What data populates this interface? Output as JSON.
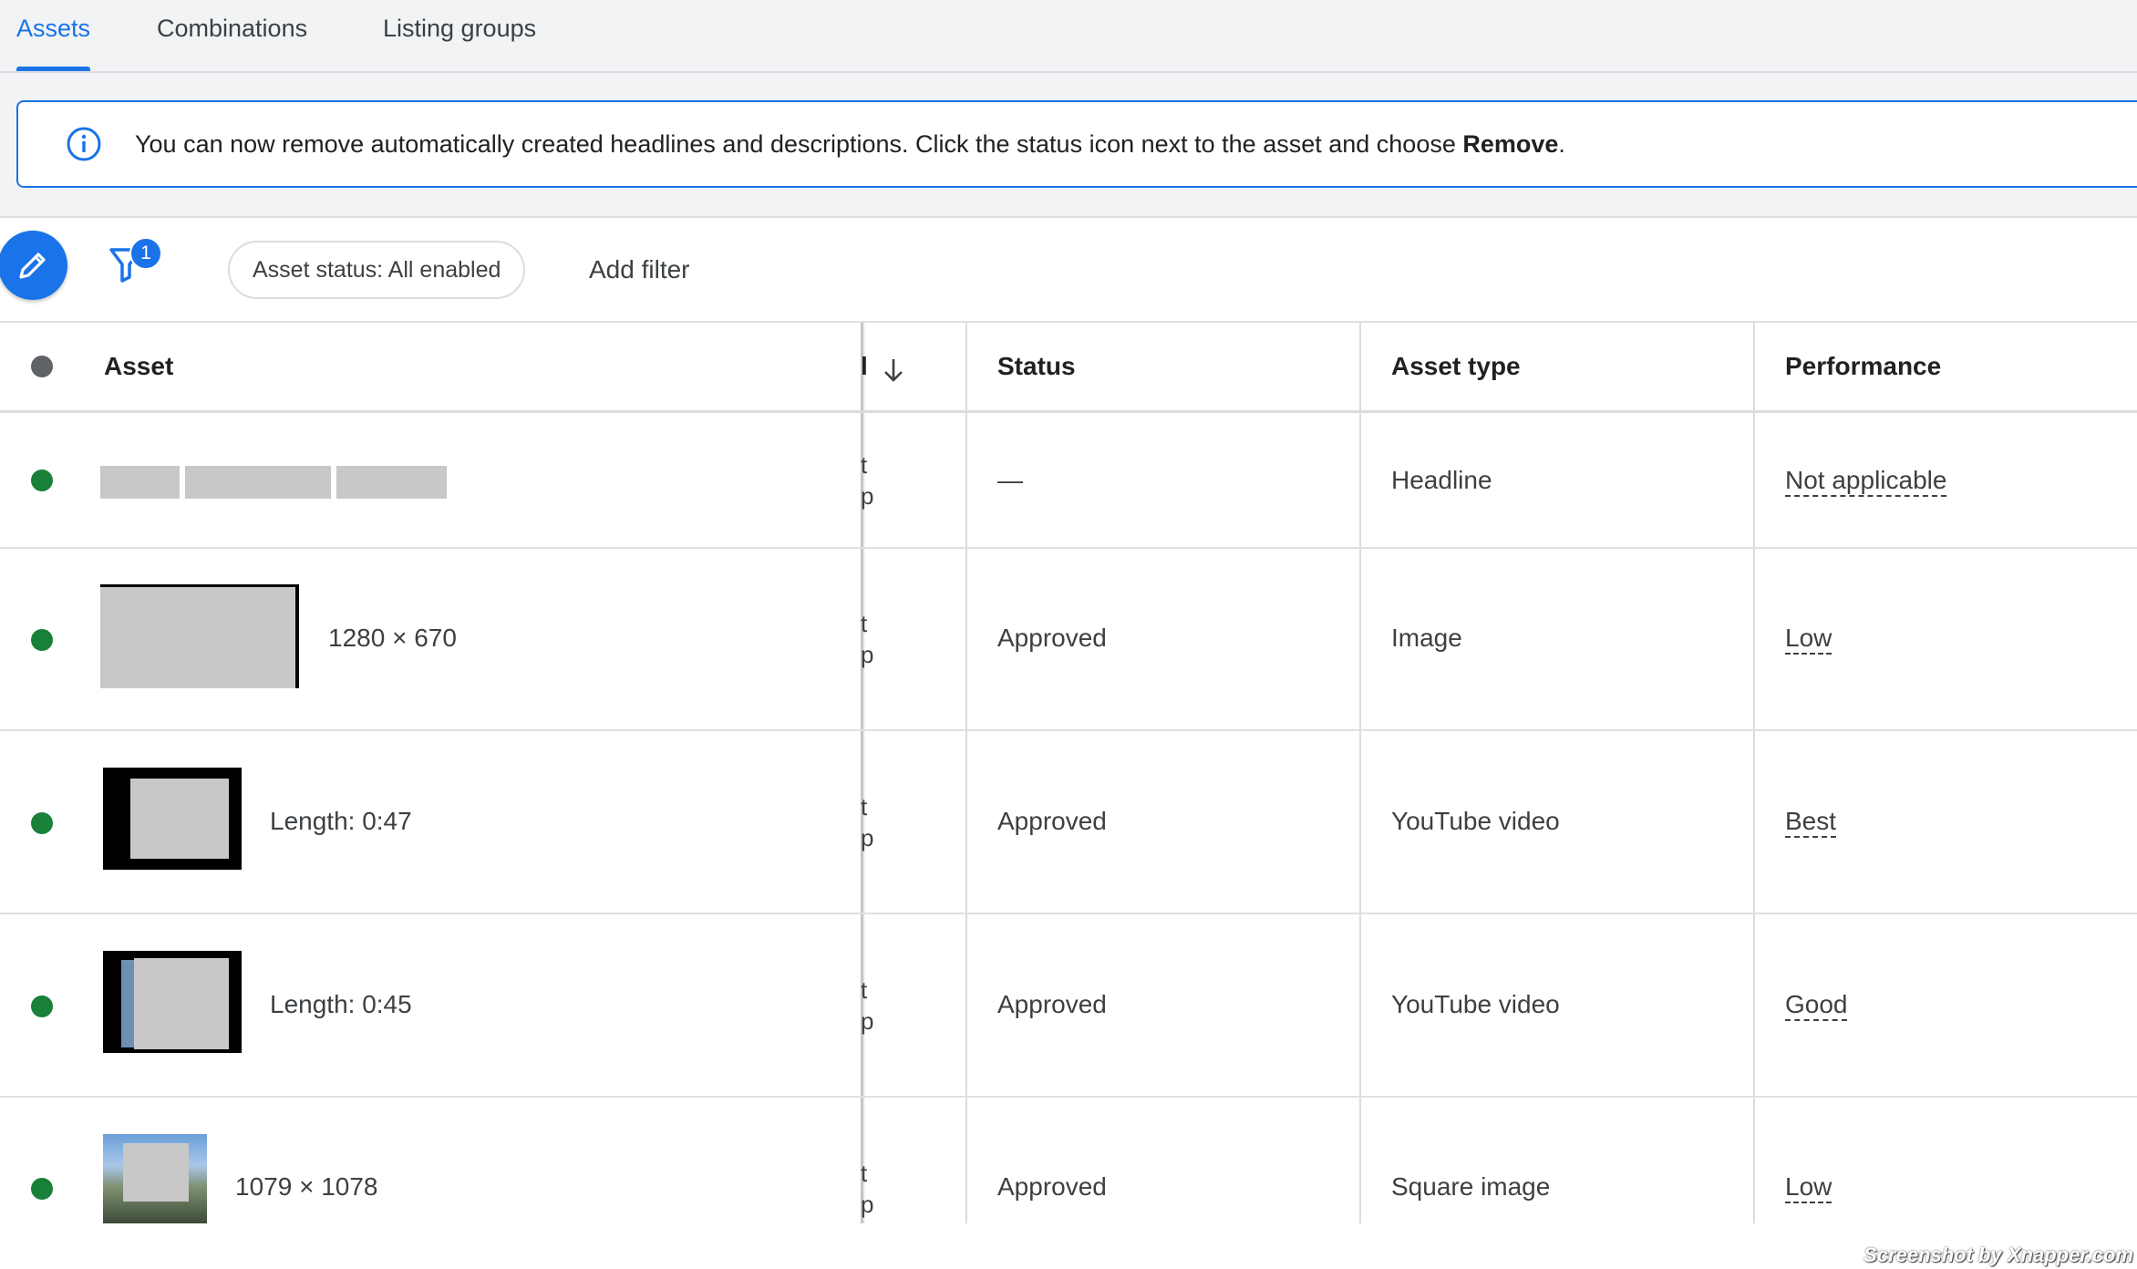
{
  "tabs": [
    {
      "label": "Assets",
      "active": true
    },
    {
      "label": "Combinations",
      "active": false
    },
    {
      "label": "Listing groups",
      "active": false
    }
  ],
  "banner": {
    "text": "You can now remove automatically created headlines and descriptions. Click the status icon next to the asset and choose ",
    "bold": "Remove",
    "end": "."
  },
  "toolbar": {
    "filter_count": "1",
    "chip_label": "Asset status: All enabled",
    "add_filter": "Add filter"
  },
  "table": {
    "headers": {
      "asset": "Asset",
      "clipped": "l",
      "status": "Status",
      "asset_type": "Asset type",
      "performance": "Performance"
    },
    "clipped_lines": [
      "t",
      "p"
    ],
    "rows": [
      {
        "detail": "",
        "status": "—",
        "asset_type": "Headline",
        "performance": "Not applicable"
      },
      {
        "detail": "1280 × 670",
        "status": "Approved",
        "asset_type": "Image",
        "performance": "Low"
      },
      {
        "detail": "Length: 0:47",
        "status": "Approved",
        "asset_type": "YouTube video",
        "performance": "Best"
      },
      {
        "detail": "Length: 0:45",
        "status": "Approved",
        "asset_type": "YouTube video",
        "performance": "Good"
      },
      {
        "detail": "1079 × 1078",
        "status": "Approved",
        "asset_type": "Square image",
        "performance": "Low"
      }
    ]
  },
  "watermark": "Screenshot by Xnapper.com",
  "colors": {
    "accent": "#1a73e8",
    "status_enabled": "#188038",
    "header_dot": "#5f6368",
    "band_bg": "#f1f3f4"
  }
}
